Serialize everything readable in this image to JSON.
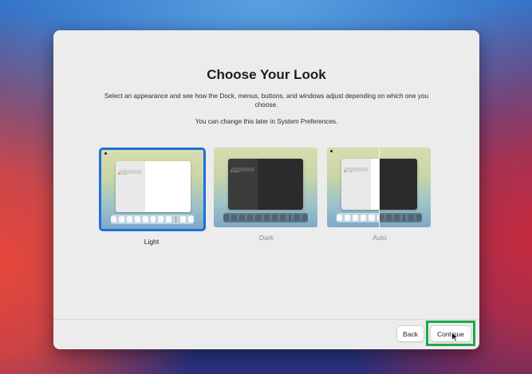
{
  "dialog": {
    "title": "Choose Your Look",
    "description": "Select an appearance and see how the Dock, menus, buttons, and windows adjust depending on which one you choose.",
    "note": "You can change this later in System Preferences."
  },
  "appearances": [
    {
      "label": "Light",
      "selected": true
    },
    {
      "label": "Dark",
      "selected": false
    },
    {
      "label": "Auto",
      "selected": false
    }
  ],
  "footer": {
    "back_label": "Back",
    "continue_label": "Continue"
  },
  "colors": {
    "selection": "#1f6fd6",
    "highlight": "#1ea84a"
  }
}
